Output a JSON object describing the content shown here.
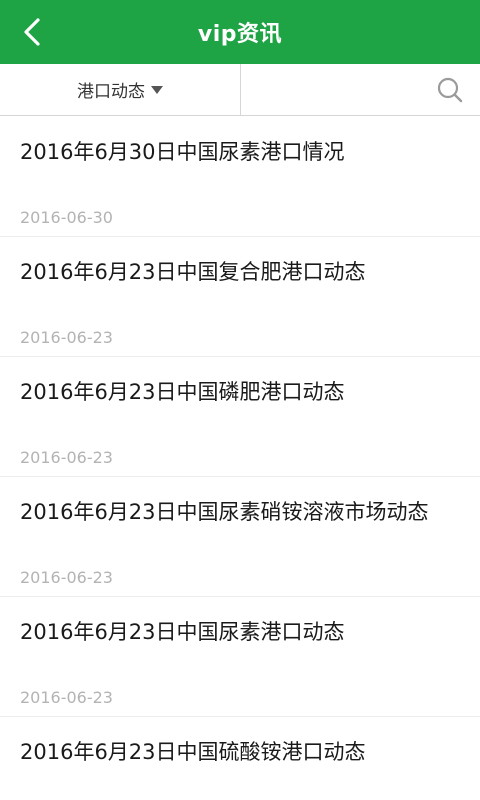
{
  "header": {
    "title": "vip资讯"
  },
  "filter": {
    "selected": "港口动态"
  },
  "items": [
    {
      "title": "2016年6月30日中国尿素港口情况",
      "date": "2016-06-30"
    },
    {
      "title": "2016年6月23日中国复合肥港口动态",
      "date": "2016-06-23"
    },
    {
      "title": "2016年6月23日中国磷肥港口动态",
      "date": "2016-06-23"
    },
    {
      "title": "2016年6月23日中国尿素硝铵溶液市场动态",
      "date": "2016-06-23"
    },
    {
      "title": "2016年6月23日中国尿素港口动态",
      "date": "2016-06-23"
    },
    {
      "title": "2016年6月23日中国硫酸铵港口动态",
      "date": ""
    }
  ],
  "icons": {
    "back": "chevron-left-icon",
    "search": "search-icon",
    "dropdown": "caret-down-icon"
  },
  "colors": {
    "header_bg": "#1ea345",
    "date_text": "#b3b3b3"
  }
}
